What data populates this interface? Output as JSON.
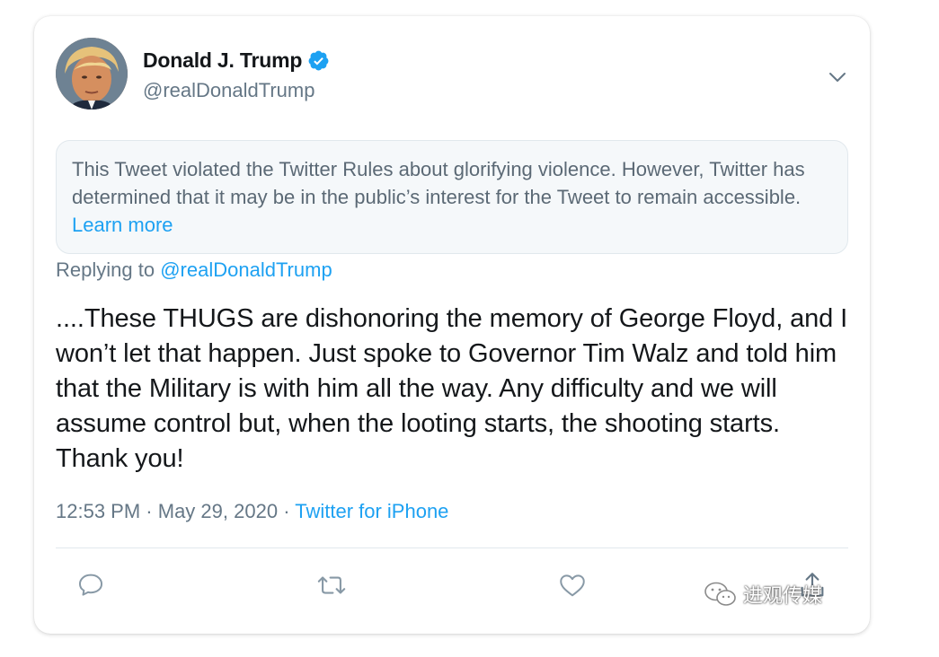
{
  "tweet": {
    "author_name": "Donald J. Trump",
    "handle": "@realDonaldTrump",
    "notice_text": "This Tweet violated the Twitter Rules about glorifying violence. However, Twitter has determined that it may be in the public’s interest for the Tweet to remain accessible.",
    "notice_link": "Learn more",
    "replying_prefix": "Replying to",
    "replying_handle": "@realDonaldTrump",
    "body": "....These THUGS are dishonoring the memory of George Floyd, and I won’t let that happen. Just spoke to Governor Tim Walz and told him that the Military is with him all the way. Any difficulty and we will assume control but, when the looting starts, the shooting starts. Thank you!",
    "time": "12:53 PM",
    "separator": "·",
    "date": "May 29, 2020",
    "source": "Twitter for iPhone"
  },
  "actions": [
    {
      "icon": "reply-icon"
    },
    {
      "icon": "retweet-icon"
    },
    {
      "icon": "like-icon"
    },
    {
      "icon": "share-icon"
    }
  ],
  "watermark": {
    "icon": "wechat-icon",
    "text": "进观传媒"
  },
  "colors": {
    "accent": "#1da1f2",
    "text": "#14171a",
    "muted": "#657786",
    "notice_bg": "#f5f8fa"
  }
}
